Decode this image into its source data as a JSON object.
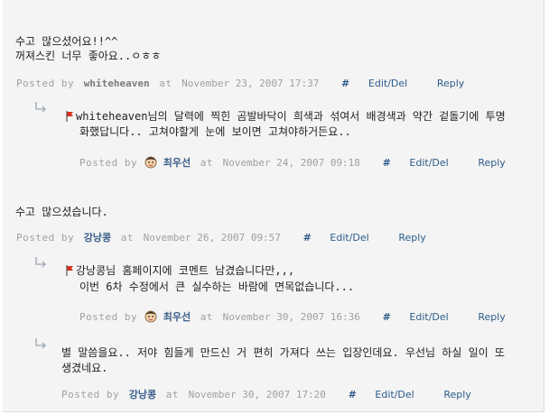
{
  "comments": [
    {
      "lines": [
        "수고 많으셨어요!!^^",
        "꺼져스킨 너무 좋아요..ㅇㅎㅎ"
      ],
      "posted_by": "Posted by",
      "author": "whiteheaven",
      "at": "at",
      "date": "November 23, 2007 17:37",
      "hash": "#",
      "edit": "Edit/Del",
      "reply": "Reply",
      "reply_entry": {
        "lines": [
          "whiteheaven님의 달력에 찍힌 곰발바닥이 희색과 섞여서 배경색과 약간 겉돌기에 투명",
          "화했답니다.. 고쳐야할게 눈에 보이면 고쳐야하거든요.."
        ],
        "posted_by": "Posted by",
        "author": "최우선",
        "at": "at",
        "date": "November 24, 2007 09:18",
        "hash": "#",
        "edit": "Edit/Del",
        "reply": "Reply"
      }
    },
    {
      "lines": [
        "수고 많으셨습니다."
      ],
      "posted_by": "Posted by",
      "author": "강낭콩",
      "at": "at",
      "date": "November 26, 2007 09:57",
      "hash": "#",
      "edit": "Edit/Del",
      "reply": "Reply",
      "reply_entry": {
        "lines": [
          "강낭콩님 홈페이지에 코멘트 남겼습니다만,,,",
          "이번 6차 수정에서 큰 실수하는 바람에 면목없습니다..."
        ],
        "posted_by": "Posted by",
        "author": "최우선",
        "at": "at",
        "date": "November 30, 2007 16:36",
        "hash": "#",
        "edit": "Edit/Del",
        "reply": "Reply"
      },
      "second_reply": {
        "lines": [
          "별 말씀을요.. 저야 힘들게 만드신 거 편히 가져다 쓰는 입장인데요. 우선님 하실 일이 또",
          "생겼네요."
        ],
        "posted_by": "Posted by",
        "author": "강낭콩",
        "at": "at",
        "date": "November 30, 2007 17:20",
        "hash": "#",
        "edit": "Edit/Del",
        "reply": "Reply"
      }
    }
  ]
}
